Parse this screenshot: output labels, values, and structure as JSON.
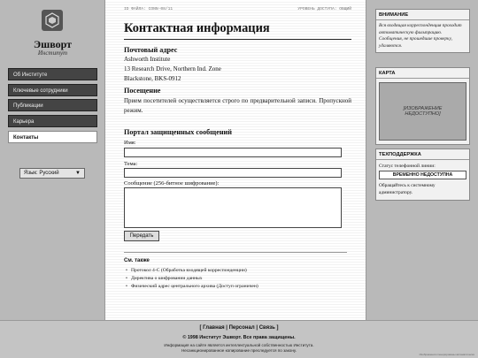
{
  "header": {
    "file_id": "ID ФАЙЛА: CONN-08/11",
    "access_level": "УРОВЕНЬ ДОСТУПА: ОБЩИЙ"
  },
  "brand": {
    "name": "Эшворт",
    "subtitle": "Институт"
  },
  "nav": {
    "items": [
      {
        "label": "Об Институте"
      },
      {
        "label": "Ключевые сотрудники"
      },
      {
        "label": "Публикации"
      },
      {
        "label": "Карьера"
      },
      {
        "label": "Контакты"
      }
    ],
    "active_index": 4
  },
  "language_select": {
    "value": "Язык: Русский"
  },
  "main": {
    "title": "Контактная информация",
    "postal": {
      "heading": "Почтовый адрес",
      "line1": "Ashworth Institute",
      "line2": "13 Research Drive, Northern Ind. Zone",
      "line3": "Blackstone, BKS-0912"
    },
    "visits": {
      "heading": "Посещение",
      "text": "Прием посетителей осуществляется строго по предварительной записи. Пропускной режим."
    },
    "portal": {
      "heading": "Портал защищенных сообщений",
      "name_label": "Имя:",
      "subject_label": "Тема:",
      "message_label": "Сообщение (256-битное шифрование):",
      "submit_label": "Передать"
    },
    "see_also": {
      "heading": "См. также",
      "items": [
        "Протокол 4-С (Обработка входящей корреспонденции)",
        "Директива о шифровании данных",
        "Физический адрес центрального архива (Доступ ограничен)"
      ]
    }
  },
  "sidebar_right": {
    "notice": {
      "heading": "ВНИМАНИЕ",
      "text": "Вся входящая корреспонденция проходит автоматическую фильтрацию. Сообщения, не прошедшие проверку, удаляются."
    },
    "map": {
      "heading": "КАРТА",
      "placeholder": "[ИЗОБРАЖЕНИЕ НЕДОСТУПНО]"
    },
    "support": {
      "heading": "ТЕХПОДДЕРЖКА",
      "status_label": "Статус телефонной линии:",
      "status_value": "ВРЕМЕННО НЕДОСТУПНА",
      "note": "Обращайтесь к системному администратору."
    }
  },
  "footer": {
    "links": "[ Главная | Персонал | Связь ]",
    "copyright": "© 1998 Институт Эшворт. Все права защищены.",
    "note_line1": "Информация на сайте является интеллектуальной собственностью Института.",
    "note_line2": "Несанкционированное копирование преследуется по закону.",
    "tiny": "Изображения сгенерированы автоматически"
  },
  "colors": {
    "sidebar": "#b9b9b9",
    "nav_item": "#444444",
    "footer": "#c4c4c4"
  }
}
